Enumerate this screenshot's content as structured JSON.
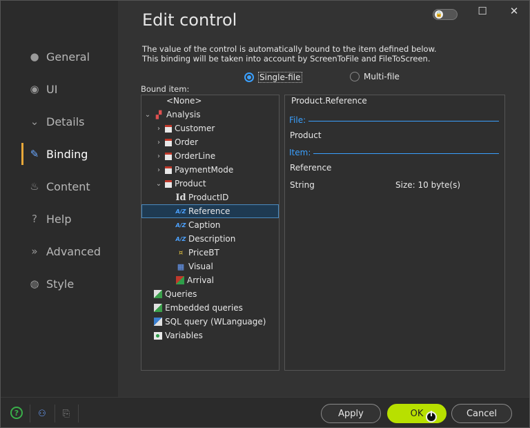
{
  "dialog": {
    "title": "Edit control",
    "description_line1": "The value of the control is automatically bound to the item defined below.",
    "description_line2": "This binding will be taken into account by ScreenToFile and FileToScreen."
  },
  "sidebar": {
    "items": [
      {
        "label": "General",
        "icon": "circle-icon",
        "active": false
      },
      {
        "label": "UI",
        "icon": "eye-icon",
        "active": false
      },
      {
        "label": "Details",
        "icon": "chevron-circle-icon",
        "active": false
      },
      {
        "label": "Binding",
        "icon": "binding-icon",
        "active": true
      },
      {
        "label": "Content",
        "icon": "flask-icon",
        "active": false
      },
      {
        "label": "Help",
        "icon": "help-icon",
        "active": false
      },
      {
        "label": "Advanced",
        "icon": "advanced-icon",
        "active": false
      },
      {
        "label": "Style",
        "icon": "palette-icon",
        "active": false
      }
    ]
  },
  "binding_mode": {
    "single_file": "Single-file",
    "multi_file": "Multi-file",
    "selected": "Single-file"
  },
  "bound_item": {
    "label": "Bound item:",
    "tree": {
      "none": "<None>",
      "analysis": "Analysis",
      "customer": "Customer",
      "order": "Order",
      "orderline": "OrderLine",
      "paymentmode": "PaymentMode",
      "product": "Product",
      "productid": "ProductID",
      "reference": "Reference",
      "caption": "Caption",
      "description": "Description",
      "pricebt": "PriceBT",
      "visual": "Visual",
      "arrival": "Arrival",
      "queries": "Queries",
      "embedded_queries": "Embedded queries",
      "sql_query": "SQL query (WLanguage)",
      "variables": "Variables"
    },
    "selected": "Reference"
  },
  "details": {
    "header": "Product.Reference",
    "file_section": "File:",
    "file_value": "Product",
    "item_section": "Item:",
    "item_value": "Reference",
    "type_value": "String",
    "size_value": "Size: 10 byte(s)"
  },
  "footer": {
    "apply_label": "Apply",
    "ok_label": "OK",
    "cancel_label": "Cancel"
  },
  "colors": {
    "accent": "#3aa0ff",
    "ok_button": "#b8e000",
    "active_marker": "#e8a83a"
  }
}
